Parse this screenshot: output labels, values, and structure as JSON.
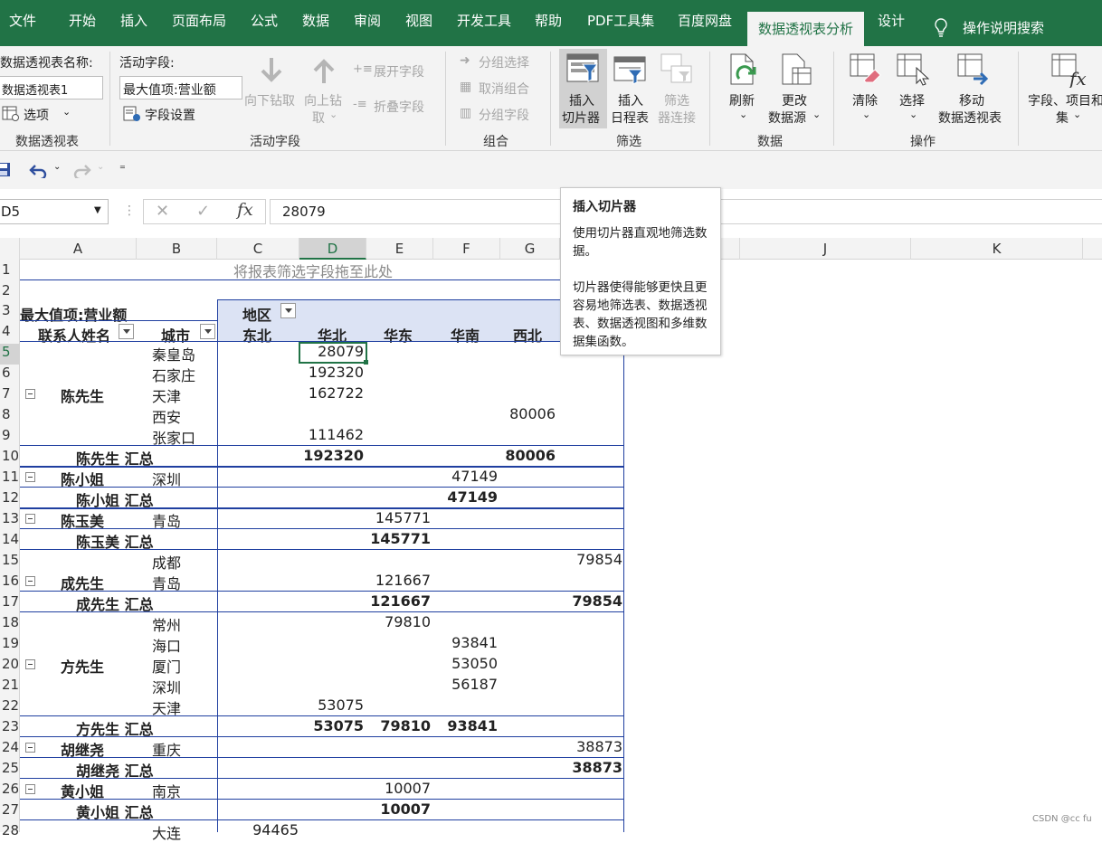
{
  "tabs": [
    {
      "label": "文件"
    },
    {
      "label": "开始"
    },
    {
      "label": "插入"
    },
    {
      "label": "页面布局"
    },
    {
      "label": "公式"
    },
    {
      "label": "数据"
    },
    {
      "label": "审阅"
    },
    {
      "label": "视图"
    },
    {
      "label": "开发工具"
    },
    {
      "label": "帮助"
    },
    {
      "label": "PDF工具集"
    },
    {
      "label": "百度网盘"
    },
    {
      "label": "数据透视表分析"
    },
    {
      "label": "设计"
    }
  ],
  "tell_me": "操作说明搜索",
  "ribbon": {
    "pt_name_label": "数据透视表名称:",
    "pt_name_value": "数据透视表1",
    "options": "选项",
    "group_pt": "数据透视表",
    "active_field_label": "活动字段:",
    "active_field_value": "最大值项:营业额",
    "field_settings": "字段设置",
    "drill_down": "向下钻取",
    "drill_up_1": "向上钻",
    "drill_up_2": "取",
    "expand_field": "展开字段",
    "collapse_field": "折叠字段",
    "group_active": "活动字段",
    "group_selection": "分组选择",
    "ungroup": "取消组合",
    "group_field": "分组字段",
    "group_group": "组合",
    "insert_slicer_1": "插入",
    "insert_slicer_2": "切片器",
    "insert_timeline_1": "插入",
    "insert_timeline_2": "日程表",
    "filter_conn_1": "筛选",
    "filter_conn_2": "器连接",
    "group_filter": "筛选",
    "refresh": "刷新",
    "change_source_1": "更改",
    "change_source_2": "数据源",
    "group_data": "数据",
    "clear": "清除",
    "select": "选择",
    "move_1": "移动",
    "move_2": "数据透视表",
    "group_actions": "操作",
    "fields_items_1": "字段、项目和",
    "fields_items_2": "集"
  },
  "formula_bar": {
    "name_box": "D5",
    "value": "28079"
  },
  "columns": [
    "A",
    "B",
    "C",
    "D",
    "E",
    "F",
    "G",
    "J",
    "K"
  ],
  "rows": [
    "1",
    "2",
    "3",
    "4",
    "5",
    "6",
    "7",
    "8",
    "9",
    "10",
    "11",
    "12",
    "13",
    "14",
    "15",
    "16",
    "17",
    "18",
    "19",
    "20",
    "21",
    "22",
    "23",
    "24",
    "25",
    "26",
    "27",
    "28"
  ],
  "pivot": {
    "filter_drop": "将报表筛选字段拖至此处",
    "value_field": "最大值项:营业额",
    "col_field": "地区",
    "row_field1": "联系人姓名",
    "row_field2": "城市",
    "regions": [
      "东北",
      "华北",
      "华东",
      "华南",
      "西北"
    ],
    "r5": {
      "city": "秦皇岛",
      "d": "28079"
    },
    "r6": {
      "city": "石家庄",
      "d": "192320"
    },
    "r7": {
      "name": "陈先生",
      "city": "天津",
      "d": "162722"
    },
    "r8": {
      "city": "西安",
      "g": "80006"
    },
    "r9": {
      "city": "张家口",
      "d": "111462"
    },
    "r10": {
      "total": "陈先生 汇总",
      "d": "192320",
      "g": "80006"
    },
    "r11": {
      "name": "陈小姐",
      "city": "深圳",
      "f": "47149"
    },
    "r12": {
      "total": "陈小姐 汇总",
      "f": "47149"
    },
    "r13": {
      "name": "陈玉美",
      "city": "青岛",
      "e": "145771"
    },
    "r14": {
      "total": "陈玉美 汇总",
      "e": "145771"
    },
    "r15": {
      "city": "成都",
      "h": "79854"
    },
    "r16": {
      "name": "成先生",
      "city": "青岛",
      "e": "121667"
    },
    "r17": {
      "total": "成先生 汇总",
      "e": "121667",
      "h": "79854"
    },
    "r18": {
      "city": "常州",
      "e": "79810"
    },
    "r19": {
      "city": "海口",
      "f": "93841"
    },
    "r20": {
      "name": "方先生",
      "city": "厦门",
      "f": "53050"
    },
    "r21": {
      "city": "深圳",
      "f": "56187"
    },
    "r22": {
      "city": "天津",
      "d": "53075"
    },
    "r23": {
      "total": "方先生 汇总",
      "d": "53075",
      "e": "79810",
      "f": "93841"
    },
    "r24": {
      "name": "胡继尧",
      "city": "重庆",
      "h": "38873"
    },
    "r25": {
      "total": "胡继尧 汇总",
      "h": "38873"
    },
    "r26": {
      "name": "黄小姐",
      "city": "南京",
      "e": "10007"
    },
    "r27": {
      "total": "黄小姐 汇总",
      "e": "10007"
    },
    "r28": {
      "city": "大连",
      "c": "94465"
    }
  },
  "tooltip": {
    "title": "插入切片器",
    "p1": "使用切片器直观地筛选数据。",
    "p2": "切片器使得能够更快且更容易地筛选表、数据透视表、数据透视图和多维数据集函数。"
  },
  "watermark": "CSDN @cc fu",
  "colors": {
    "accent": "#217346",
    "pivot_border": "#1f3fa0",
    "header_fill": "#dce3f4"
  }
}
